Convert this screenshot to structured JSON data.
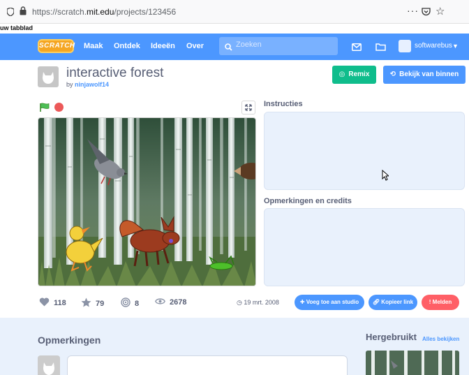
{
  "browser": {
    "url_prefix": "https://scratch.",
    "url_domain": "mit.edu",
    "url_path": "/projects/123456",
    "menu_dots": "···",
    "bookmark_label": "uw tabblad"
  },
  "nav": {
    "logo": "SCRATCH",
    "links": [
      "Maak",
      "Ontdek",
      "Ideeën",
      "Over"
    ],
    "search_placeholder": "Zoeken",
    "username": "softwarebus"
  },
  "project": {
    "title": "interactive forest",
    "by_label": "by",
    "author": "ninjawolf14",
    "remix_label": "Remix",
    "see_inside_label": "Bekijk van binnen"
  },
  "panels": {
    "instructions_label": "Instructies",
    "credits_label": "Opmerkingen en credits"
  },
  "stats": {
    "loves": "118",
    "favorites": "79",
    "remixes": "8",
    "views": "2678",
    "shared_date": "19 mrt. 2008"
  },
  "actions": {
    "add_to_studio": "Voeg toe aan studio",
    "copy_link": "Kopieer link",
    "report": "Melden"
  },
  "bottom": {
    "comments_title": "Opmerkingen",
    "remixes_title": "Hergebruikt",
    "see_all": "Alles bekijken"
  },
  "colors": {
    "nav_blue": "#4c97ff",
    "remix_green": "#0fbd8c",
    "report_red": "#ff5f66",
    "panel_bg": "#e9f1fc"
  },
  "icons": [
    "shield-icon",
    "lock-icon",
    "pocket-icon",
    "bookmark-star-icon",
    "search-icon",
    "mail-icon",
    "folder-icon",
    "green-flag-icon",
    "stop-icon",
    "fullscreen-icon",
    "heart-icon",
    "star-icon",
    "remix-icon",
    "eye-icon"
  ]
}
